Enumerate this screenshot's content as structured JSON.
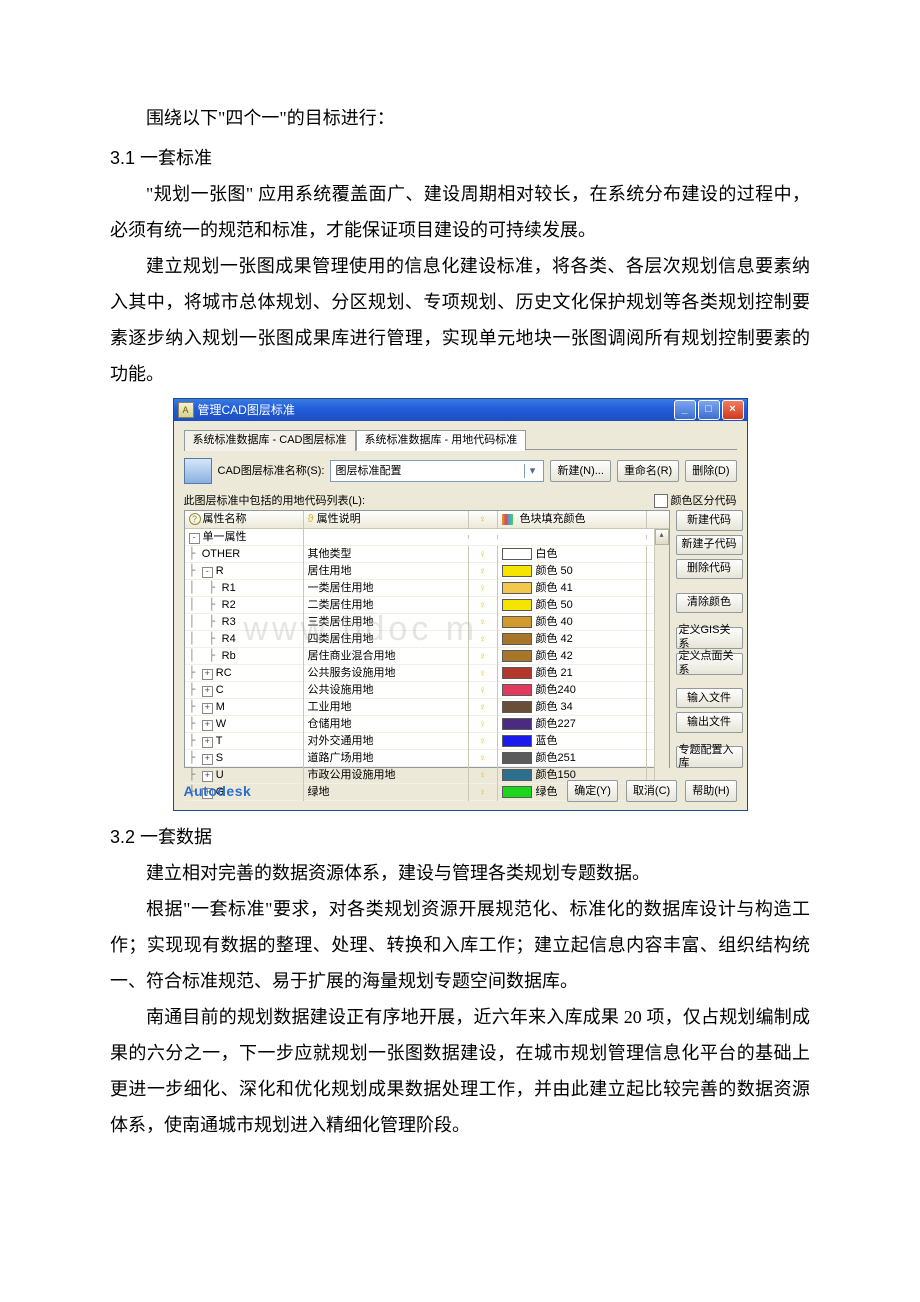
{
  "doc": {
    "pre_para": "围绕以下\"四个一\"的目标进行：",
    "h31_num": "3.1 ",
    "h31_title": "一套标准",
    "h31_p1": "\"规划一张图\" 应用系统覆盖面广、建设周期相对较长，在系统分布建设的过程中，必须有统一的规范和标准，才能保证项目建设的可持续发展。",
    "h31_p2": "建立规划一张图成果管理使用的信息化建设标准，将各类、各层次规划信息要素纳入其中，将城市总体规划、分区规划、专项规划、历史文化保护规划等各类规划控制要素逐步纳入规划一张图成果库进行管理，实现单元地块一张图调阅所有规划控制要素的功能。",
    "h32_num": "3.2 ",
    "h32_title": "一套数据",
    "h32_p1": "建立相对完善的数据资源体系，建设与管理各类规划专题数据。",
    "h32_p2": "根据\"一套标准\"要求，对各类规划资源开展规范化、标准化的数据库设计与构造工作；实现现有数据的整理、处理、转换和入库工作；建立起信息内容丰富、组织结构统一、符合标准规范、易于扩展的海量规划专题空间数据库。",
    "h32_p3": "南通目前的规划数据建设正有序地开展，近六年来入库成果 20 项，仅占规划编制成果的六分之一，下一步应就规划一张图数据建设，在城市规划管理信息化平台的基础上更进一步细化、深化和优化规划成果数据处理工作，并由此建立起比较完善的数据资源体系，使南通城市规划进入精细化管理阶段。"
  },
  "cad": {
    "window_title": "管理CAD图层标准",
    "tabs": [
      "系统标准数据库 - CAD图层标准",
      "系统标准数据库 - 用地代码标准"
    ],
    "label_std_name": "CAD图层标准名称(S):",
    "select_value": "图层标准配置",
    "top_buttons": [
      "新建(N)...",
      "重命名(R)",
      "删除(D)"
    ],
    "list_label": "此图层标准中包括的用地代码列表(L):",
    "checkbox_label": "颜色区分代码",
    "columns": {
      "name": "属性名称",
      "desc": "属性说明",
      "bulb_hdr": "",
      "color": "色块填充颜色"
    },
    "col_icons": {
      "name_q": "?",
      "desc_bulb": "ϑ",
      "color_icon": "■"
    },
    "rows": [
      {
        "name": "单一属性",
        "desc": "",
        "bulb": "",
        "color": "",
        "swatch": "",
        "indent": 0,
        "toggle": "-"
      },
      {
        "name": "OTHER",
        "desc": "其他类型",
        "bulb": "●",
        "color": "白色",
        "swatch": "#ffffff",
        "indent": 1,
        "toggle": ""
      },
      {
        "name": "R",
        "desc": "居住用地",
        "bulb": "●",
        "color": "颜色 50",
        "swatch": "#f4e400",
        "indent": 1,
        "toggle": "-"
      },
      {
        "name": "R1",
        "desc": "一类居住用地",
        "bulb": "●",
        "color": "颜色 41",
        "swatch": "#f2c74e",
        "indent": 2,
        "toggle": ""
      },
      {
        "name": "R2",
        "desc": "二类居住用地",
        "bulb": "●",
        "color": "颜色 50",
        "swatch": "#f4e400",
        "indent": 2,
        "toggle": ""
      },
      {
        "name": "R3",
        "desc": "三类居住用地",
        "bulb": "●",
        "color": "颜色 40",
        "swatch": "#d19a2d",
        "indent": 2,
        "toggle": ""
      },
      {
        "name": "R4",
        "desc": "四类居住用地",
        "bulb": "●",
        "color": "颜色 42",
        "swatch": "#a87628",
        "indent": 2,
        "toggle": ""
      },
      {
        "name": "Rb",
        "desc": "居住商业混合用地",
        "bulb": "●",
        "color": "颜色 42",
        "swatch": "#a87628",
        "indent": 2,
        "toggle": ""
      },
      {
        "name": "RC",
        "desc": "公共服务设施用地",
        "bulb": "●",
        "color": "颜色 21",
        "swatch": "#b2382e",
        "indent": 1,
        "toggle": "+"
      },
      {
        "name": "C",
        "desc": "公共设施用地",
        "bulb": "●",
        "color": "颜色240",
        "swatch": "#e03a5e",
        "indent": 1,
        "toggle": "+"
      },
      {
        "name": "M",
        "desc": "工业用地",
        "bulb": "●",
        "color": "颜色 34",
        "swatch": "#6a4e3a",
        "indent": 1,
        "toggle": "+"
      },
      {
        "name": "W",
        "desc": "仓储用地",
        "bulb": "●",
        "color": "颜色227",
        "swatch": "#4b2a82",
        "indent": 1,
        "toggle": "+"
      },
      {
        "name": "T",
        "desc": "对外交通用地",
        "bulb": "●",
        "color": "蓝色",
        "swatch": "#1a1aec",
        "indent": 1,
        "toggle": "+"
      },
      {
        "name": "S",
        "desc": "道路广场用地",
        "bulb": "●",
        "color": "颜色251",
        "swatch": "#5a5a5a",
        "indent": 1,
        "toggle": "+"
      },
      {
        "name": "U",
        "desc": "市政公用设施用地",
        "bulb": "●",
        "color": "颜色150",
        "swatch": "#2e6e8f",
        "indent": 1,
        "toggle": "+"
      },
      {
        "name": "G",
        "desc": "绿地",
        "bulb": "●",
        "color": "绿色",
        "swatch": "#1bd61b",
        "indent": 1,
        "toggle": "+"
      }
    ],
    "sidebar_buttons": [
      "新建代码",
      "新建子代码",
      "删除代码",
      "清除颜色",
      "定义GIS关系",
      "定义点面关系",
      "输入文件",
      "输出文件",
      "专题配置入库"
    ],
    "footer_brand": "Autodesk",
    "footer_buttons": [
      "确定(Y)",
      "取消(C)",
      "帮助(H)"
    ],
    "watermark": "www   bdoc   m"
  }
}
